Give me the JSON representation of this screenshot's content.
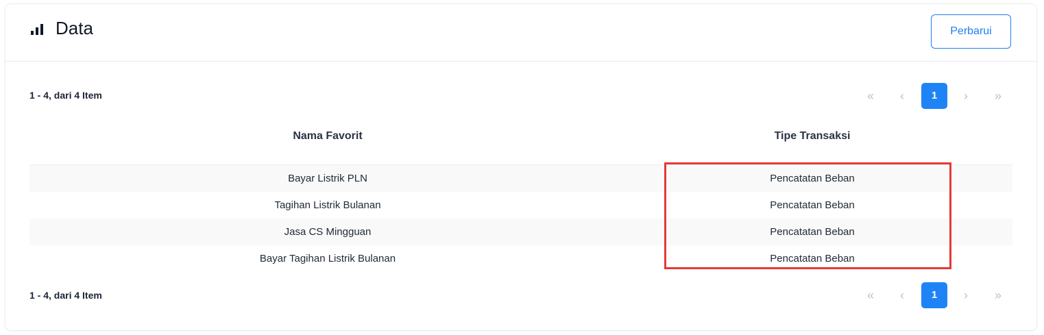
{
  "header": {
    "icon": "bar-chart-icon",
    "title": "Data",
    "refresh_label": "Perbarui",
    "accent_color": "#1e7ef0"
  },
  "pagination": {
    "summary": "1 - 4, dari 4 Item",
    "first": "«",
    "prev": "‹",
    "current": "1",
    "next": "›",
    "last": "»",
    "active_color": "#1e84f5"
  },
  "table": {
    "columns": [
      "Nama Favorit",
      "Tipe Transaksi"
    ],
    "rows": [
      [
        "Bayar Listrik PLN",
        "Pencatatan Beban"
      ],
      [
        "Tagihan Listrik Bulanan",
        "Pencatatan Beban"
      ],
      [
        "Jasa CS Mingguan",
        "Pencatatan Beban"
      ],
      [
        "Bayar Tagihan Listrik Bulanan",
        "Pencatatan Beban"
      ]
    ]
  },
  "annotation": {
    "highlight_color": "#e53935"
  }
}
